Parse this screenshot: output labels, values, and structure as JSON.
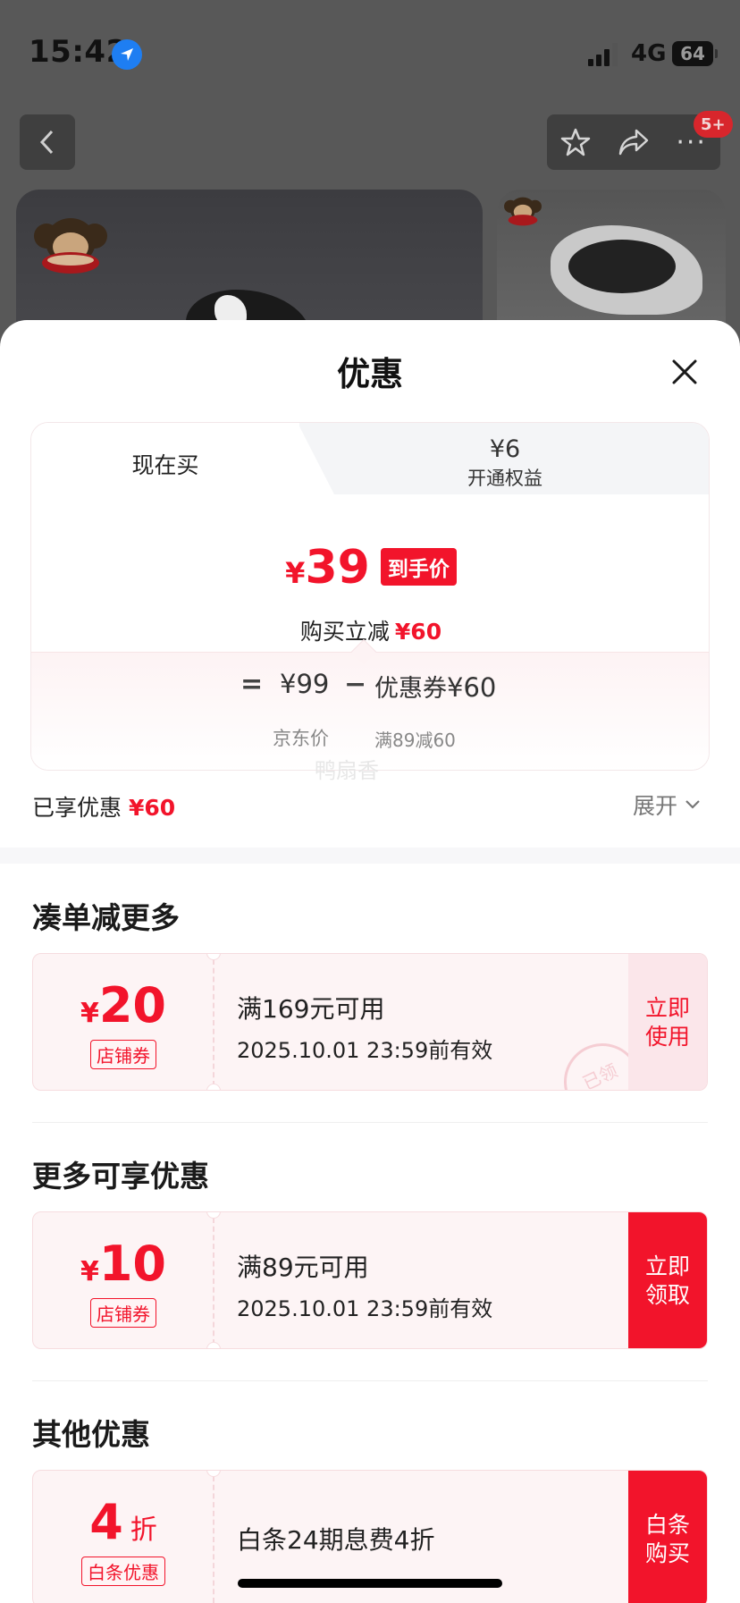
{
  "status_bar": {
    "time": "15:42",
    "network": "4G",
    "battery": "64"
  },
  "background": {
    "badge": "5+"
  },
  "sheet": {
    "title": "优惠",
    "tabs": {
      "buy_now": "现在买",
      "member_amount": "¥6",
      "member_label": "开通权益"
    },
    "price": {
      "currency": "¥",
      "value": "39",
      "tag": "到手价"
    },
    "saving": {
      "label": "购买立减",
      "amount": "¥60"
    },
    "calc": {
      "equals": "=",
      "price": "¥99",
      "minus": "−",
      "coupon_label": "优惠券",
      "coupon_amount": "¥60",
      "price_label": "京东价",
      "coupon_rule": "满89减60"
    },
    "watermark": "鸭扇香",
    "enjoyed": {
      "label": "已享优惠",
      "amount": "¥60"
    },
    "expand": "展开"
  },
  "sections": [
    {
      "title": "凑单减更多",
      "coupon": {
        "currency": "¥",
        "amount": "20",
        "type": "店铺券",
        "condition": "满169元可用",
        "validity": "2025.10.01 23:59前有效",
        "action": "立即使用",
        "stamp": "已领"
      }
    },
    {
      "title": "更多可享优惠",
      "coupon": {
        "currency": "¥",
        "amount": "10",
        "type": "店铺券",
        "condition": "满89元可用",
        "validity": "2025.10.01 23:59前有效",
        "action": "立即领取"
      }
    },
    {
      "title": "其他优惠",
      "coupon": {
        "amount": "4",
        "unit": "折",
        "type": "白条优惠",
        "condition": "白条24期息费4折",
        "action": "白条购买"
      }
    }
  ],
  "colors": {
    "accent": "#f2142b",
    "coupon_bg": "#fdf4f5"
  }
}
